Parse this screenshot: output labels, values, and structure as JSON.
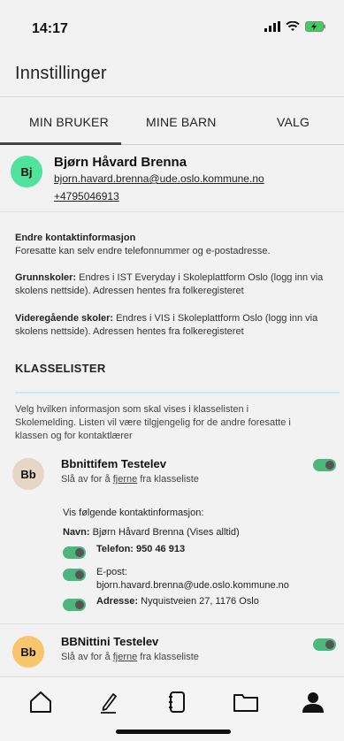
{
  "status_bar": {
    "time": "14:17"
  },
  "app_bar": {
    "title": "Innstillinger"
  },
  "tabs": [
    {
      "label": "MIN BRUKER",
      "active": true
    },
    {
      "label": "MINE BARN",
      "active": false
    },
    {
      "label": "VALG",
      "active": false
    }
  ],
  "profile": {
    "initials": "Bj",
    "avatar_color": "#4fe39b",
    "name": "Bjørn Håvard Brenna",
    "email": "bjorn.havard.brenna@ude.oslo.kommune.no",
    "phone": "+4795046913"
  },
  "contact_info": {
    "title": "Endre kontaktinformasjon",
    "text": "Foresatte kan selv endre telefonnummer og e-postadresse.",
    "primary_label": "Grunnskoler:",
    "primary_text": "Endres i IST Everyday i Skoleplattform Oslo (logg inn via skolens nettside). Adressen hentes fra folkeregisteret",
    "secondary_label": "Videregående skoler:",
    "secondary_text": "Endres i VIS i Skoleplattform Oslo (logg inn via skolens nettside). Adressen hentes fra folkeregisteret"
  },
  "class_lists": {
    "title": "KLASSELISTER",
    "description": "Velg hvilken informasjon som skal vises i klasselisten i Skolemelding. Listen vil være tilgjengelig for de andre foresatte i klassen og for kontaktlærer",
    "children": [
      {
        "initials": "Bb",
        "avatar_color": "#e7d6c6",
        "name": "Bbnittifem Testelev",
        "sub_prefix": "Slå av for å ",
        "sub_link": "fjerne",
        "sub_suffix": " fra klasseliste",
        "enabled": true,
        "contact": {
          "heading": "Vis følgende kontaktinformasjon:",
          "name_label": "Navn:",
          "name_value": "Bjørn Håvard Brenna (Vises alltid)",
          "phone_label": "Telefon:",
          "phone_value": "950 46 913",
          "phone_enabled": true,
          "email_label": "E-post:",
          "email_value": "bjorn.havard.brenna@ude.oslo.kommune.no",
          "email_enabled": true,
          "address_label": "Adresse:",
          "address_value": "Nyquistveien 27, 1176 Oslo",
          "address_enabled": true
        }
      },
      {
        "initials": "Bb",
        "avatar_color": "#f7c56b",
        "name": "BBNittini Testelev",
        "sub_prefix": "Slå av for å ",
        "sub_link": "fjerne",
        "sub_suffix": " fra klasseliste",
        "enabled": true
      }
    ]
  },
  "bottom_nav": [
    {
      "icon": "home-icon"
    },
    {
      "icon": "pencil-icon"
    },
    {
      "icon": "notebook-icon"
    },
    {
      "icon": "folder-icon"
    },
    {
      "icon": "user-icon"
    }
  ]
}
